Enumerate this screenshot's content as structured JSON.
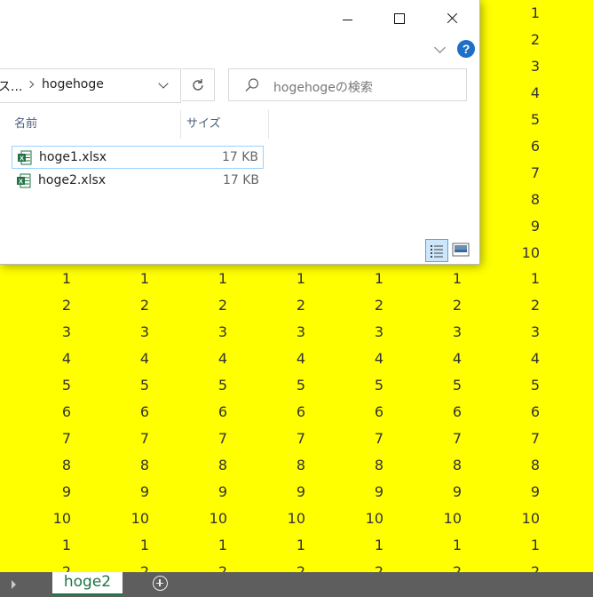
{
  "window": {
    "breadcrumb_prefix": "ス...",
    "breadcrumb_current": "hogehoge",
    "search_placeholder": "hogehogeの検索",
    "help_label": "?",
    "columns": {
      "name": "名前",
      "size": "サイズ"
    },
    "files": [
      {
        "name": "hoge1.xlsx",
        "size": "17 KB"
      },
      {
        "name": "hoge2.xlsx",
        "size": "17 KB"
      }
    ]
  },
  "sheet": {
    "top_right_column": [
      "1",
      "2",
      "3",
      "4",
      "5",
      "6",
      "7",
      "8",
      "9",
      "10"
    ],
    "block_values": [
      "1",
      "2",
      "3",
      "4",
      "5",
      "6",
      "7",
      "8",
      "9",
      "10",
      "1",
      "2"
    ],
    "tab_name": "hoge2"
  },
  "colors": {
    "background": "#ffff00",
    "excel_green": "#217346",
    "tab_bar": "#5e5e5e",
    "help_blue": "#1d6fc7"
  }
}
